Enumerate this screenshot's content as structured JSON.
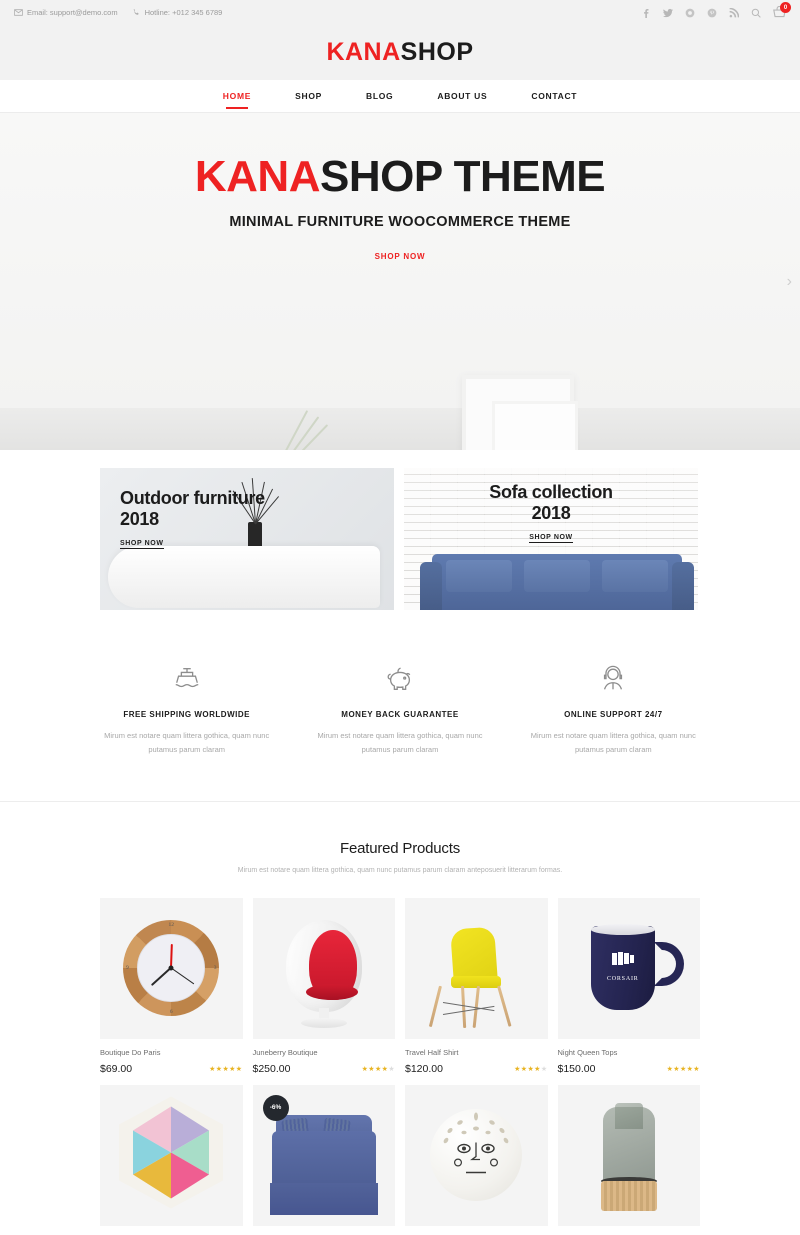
{
  "topbar": {
    "email": "Email: support@demo.com",
    "hotline": "Hotline: +012 345 6789",
    "social": [
      {
        "name": "facebook-icon"
      },
      {
        "name": "twitter-icon"
      },
      {
        "name": "instagram-icon"
      },
      {
        "name": "pinterest-icon"
      },
      {
        "name": "rss-icon"
      },
      {
        "name": "search-icon"
      }
    ],
    "cart_count": "0"
  },
  "logo": {
    "part1": "KANA",
    "part2": "SHOP"
  },
  "nav": [
    {
      "label": "HOME",
      "active": true
    },
    {
      "label": "SHOP",
      "active": false
    },
    {
      "label": "BLOG",
      "active": false
    },
    {
      "label": "ABOUT US",
      "active": false
    },
    {
      "label": "CONTACT",
      "active": false
    }
  ],
  "hero": {
    "title_red": "KANA",
    "title_black": "SHOP THEME",
    "subtitle": "MINIMAL FURNITURE WOOCOMMERCE THEME",
    "cta": "SHOP NOW",
    "next_arrow": "›"
  },
  "banners": [
    {
      "heading_line1": "Outdoor furniture",
      "heading_line2": "2018",
      "cta": "SHOP NOW"
    },
    {
      "heading_line1": "Sofa collection",
      "heading_line2": "2018",
      "cta": "SHOP NOW"
    }
  ],
  "services": [
    {
      "icon": "ship-icon",
      "title": "FREE SHIPPING WORLDWIDE",
      "text": "Mirum est notare quam littera gothica, quam nunc putamus parum claram"
    },
    {
      "icon": "piggy-bank-icon",
      "title": "MONEY BACK GUARANTEE",
      "text": "Mirum est notare quam littera gothica, quam nunc putamus parum claram"
    },
    {
      "icon": "support-headset-icon",
      "title": "ONLINE SUPPORT 24/7",
      "text": "Mirum est notare quam littera gothica, quam nunc putamus parum claram"
    }
  ],
  "featured": {
    "title": "Featured Products",
    "subtitle": "Mirum est notare quam littera gothica, quam nunc putamus parum claram anteposuerit litterarum formas.",
    "products": [
      {
        "name": "Boutique Do Paris",
        "price": "$69.00",
        "rating": 5,
        "badge": null,
        "art": "clock"
      },
      {
        "name": "Juneberry Boutique",
        "price": "$250.00",
        "rating": 4,
        "badge": null,
        "art": "egg-chair"
      },
      {
        "name": "Travel Half Shirt",
        "price": "$120.00",
        "rating": 4,
        "badge": null,
        "art": "eames-chair"
      },
      {
        "name": "Night Queen Tops",
        "price": "$150.00",
        "rating": 5,
        "badge": null,
        "art": "mug"
      },
      {
        "name": "",
        "price": "",
        "rating": 0,
        "badge": null,
        "art": "quilt-pillow"
      },
      {
        "name": "",
        "price": "",
        "rating": 0,
        "badge": "-6%",
        "art": "armchair"
      },
      {
        "name": "",
        "price": "",
        "rating": 0,
        "badge": null,
        "art": "face-ball"
      },
      {
        "name": "",
        "price": "",
        "rating": 0,
        "badge": null,
        "art": "glass-vase"
      }
    ]
  },
  "colors": {
    "accent_red": "#ee2222",
    "text_dark": "#1c1c1c",
    "muted": "#a8a8a8",
    "star": "#e8b423",
    "badge_bg": "#24282e"
  }
}
